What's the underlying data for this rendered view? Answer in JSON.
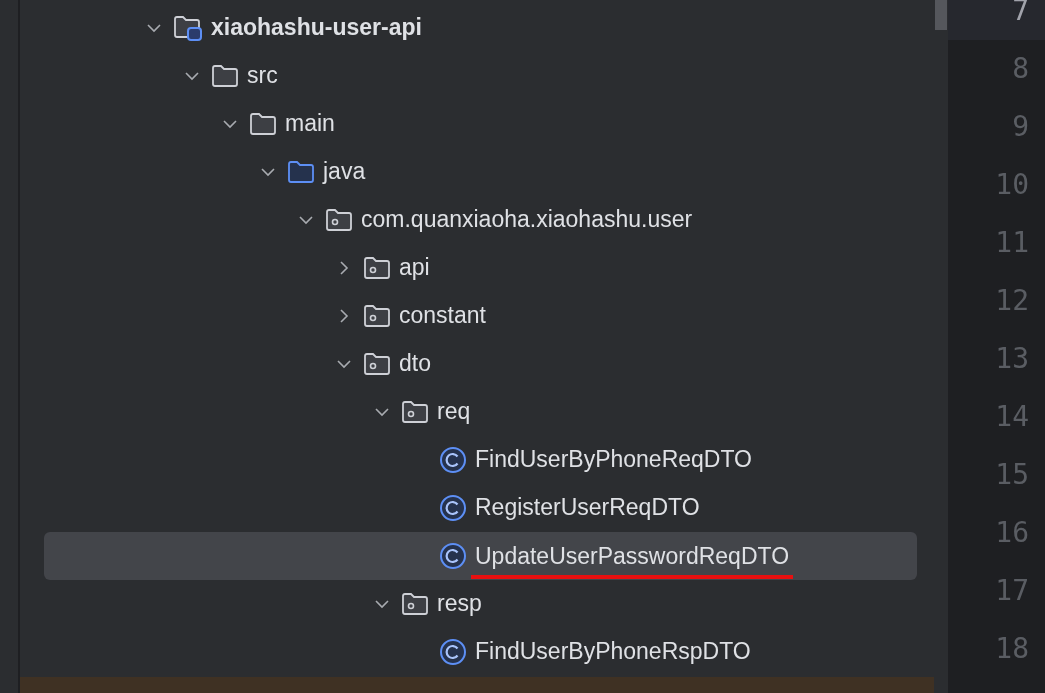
{
  "project_tree": [
    {
      "label": "xiaohashu-user-api",
      "kind": "module",
      "expanded": true,
      "selected": false,
      "children": [
        {
          "label": "src",
          "kind": "folder",
          "expanded": true,
          "selected": false,
          "children": [
            {
              "label": "main",
              "kind": "folder",
              "expanded": true,
              "selected": false,
              "children": [
                {
                  "label": "java",
                  "kind": "source-folder",
                  "expanded": true,
                  "selected": false,
                  "children": [
                    {
                      "label": "com.quanxiaoha.xiaohashu.user",
                      "kind": "package",
                      "expanded": true,
                      "selected": false,
                      "children": [
                        {
                          "label": "api",
                          "kind": "package",
                          "expanded": false,
                          "selected": false
                        },
                        {
                          "label": "constant",
                          "kind": "package",
                          "expanded": false,
                          "selected": false
                        },
                        {
                          "label": "dto",
                          "kind": "package",
                          "expanded": true,
                          "selected": false,
                          "children": [
                            {
                              "label": "req",
                              "kind": "package",
                              "expanded": true,
                              "selected": false,
                              "children": [
                                {
                                  "label": "FindUserByPhoneReqDTO",
                                  "kind": "class",
                                  "selected": false
                                },
                                {
                                  "label": "RegisterUserReqDTO",
                                  "kind": "class",
                                  "selected": false
                                },
                                {
                                  "label": "UpdateUserPasswordReqDTO",
                                  "kind": "class",
                                  "selected": true,
                                  "underlined": true
                                }
                              ]
                            },
                            {
                              "label": "resp",
                              "kind": "package",
                              "expanded": true,
                              "selected": false,
                              "children": [
                                {
                                  "label": "FindUserByPhoneRspDTO",
                                  "kind": "class",
                                  "selected": false
                                }
                              ]
                            }
                          ]
                        }
                      ]
                    }
                  ]
                }
              ]
            }
          ]
        }
      ]
    }
  ],
  "line_numbers": [
    {
      "text": "7",
      "current": true
    },
    {
      "text": "8",
      "current": false
    },
    {
      "text": "9",
      "current": false
    },
    {
      "text": "10",
      "current": false
    },
    {
      "text": "11",
      "current": false
    },
    {
      "text": "12",
      "current": false
    },
    {
      "text": "13",
      "current": false
    },
    {
      "text": "14",
      "current": false
    },
    {
      "text": "15",
      "current": false
    },
    {
      "text": "16",
      "current": false
    },
    {
      "text": "17",
      "current": false
    },
    {
      "text": "18",
      "current": false
    }
  ]
}
